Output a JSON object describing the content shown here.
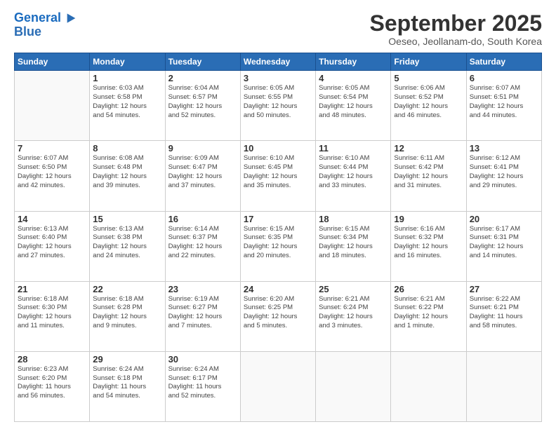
{
  "logo": {
    "line1": "General",
    "line2": "Blue"
  },
  "title": "September 2025",
  "subtitle": "Oeseo, Jeollanam-do, South Korea",
  "days_of_week": [
    "Sunday",
    "Monday",
    "Tuesday",
    "Wednesday",
    "Thursday",
    "Friday",
    "Saturday"
  ],
  "weeks": [
    [
      {
        "day": "",
        "info": ""
      },
      {
        "day": "1",
        "info": "Sunrise: 6:03 AM\nSunset: 6:58 PM\nDaylight: 12 hours\nand 54 minutes."
      },
      {
        "day": "2",
        "info": "Sunrise: 6:04 AM\nSunset: 6:57 PM\nDaylight: 12 hours\nand 52 minutes."
      },
      {
        "day": "3",
        "info": "Sunrise: 6:05 AM\nSunset: 6:55 PM\nDaylight: 12 hours\nand 50 minutes."
      },
      {
        "day": "4",
        "info": "Sunrise: 6:05 AM\nSunset: 6:54 PM\nDaylight: 12 hours\nand 48 minutes."
      },
      {
        "day": "5",
        "info": "Sunrise: 6:06 AM\nSunset: 6:52 PM\nDaylight: 12 hours\nand 46 minutes."
      },
      {
        "day": "6",
        "info": "Sunrise: 6:07 AM\nSunset: 6:51 PM\nDaylight: 12 hours\nand 44 minutes."
      }
    ],
    [
      {
        "day": "7",
        "info": "Sunrise: 6:07 AM\nSunset: 6:50 PM\nDaylight: 12 hours\nand 42 minutes."
      },
      {
        "day": "8",
        "info": "Sunrise: 6:08 AM\nSunset: 6:48 PM\nDaylight: 12 hours\nand 39 minutes."
      },
      {
        "day": "9",
        "info": "Sunrise: 6:09 AM\nSunset: 6:47 PM\nDaylight: 12 hours\nand 37 minutes."
      },
      {
        "day": "10",
        "info": "Sunrise: 6:10 AM\nSunset: 6:45 PM\nDaylight: 12 hours\nand 35 minutes."
      },
      {
        "day": "11",
        "info": "Sunrise: 6:10 AM\nSunset: 6:44 PM\nDaylight: 12 hours\nand 33 minutes."
      },
      {
        "day": "12",
        "info": "Sunrise: 6:11 AM\nSunset: 6:42 PM\nDaylight: 12 hours\nand 31 minutes."
      },
      {
        "day": "13",
        "info": "Sunrise: 6:12 AM\nSunset: 6:41 PM\nDaylight: 12 hours\nand 29 minutes."
      }
    ],
    [
      {
        "day": "14",
        "info": "Sunrise: 6:13 AM\nSunset: 6:40 PM\nDaylight: 12 hours\nand 27 minutes."
      },
      {
        "day": "15",
        "info": "Sunrise: 6:13 AM\nSunset: 6:38 PM\nDaylight: 12 hours\nand 24 minutes."
      },
      {
        "day": "16",
        "info": "Sunrise: 6:14 AM\nSunset: 6:37 PM\nDaylight: 12 hours\nand 22 minutes."
      },
      {
        "day": "17",
        "info": "Sunrise: 6:15 AM\nSunset: 6:35 PM\nDaylight: 12 hours\nand 20 minutes."
      },
      {
        "day": "18",
        "info": "Sunrise: 6:15 AM\nSunset: 6:34 PM\nDaylight: 12 hours\nand 18 minutes."
      },
      {
        "day": "19",
        "info": "Sunrise: 6:16 AM\nSunset: 6:32 PM\nDaylight: 12 hours\nand 16 minutes."
      },
      {
        "day": "20",
        "info": "Sunrise: 6:17 AM\nSunset: 6:31 PM\nDaylight: 12 hours\nand 14 minutes."
      }
    ],
    [
      {
        "day": "21",
        "info": "Sunrise: 6:18 AM\nSunset: 6:30 PM\nDaylight: 12 hours\nand 11 minutes."
      },
      {
        "day": "22",
        "info": "Sunrise: 6:18 AM\nSunset: 6:28 PM\nDaylight: 12 hours\nand 9 minutes."
      },
      {
        "day": "23",
        "info": "Sunrise: 6:19 AM\nSunset: 6:27 PM\nDaylight: 12 hours\nand 7 minutes."
      },
      {
        "day": "24",
        "info": "Sunrise: 6:20 AM\nSunset: 6:25 PM\nDaylight: 12 hours\nand 5 minutes."
      },
      {
        "day": "25",
        "info": "Sunrise: 6:21 AM\nSunset: 6:24 PM\nDaylight: 12 hours\nand 3 minutes."
      },
      {
        "day": "26",
        "info": "Sunrise: 6:21 AM\nSunset: 6:22 PM\nDaylight: 12 hours\nand 1 minute."
      },
      {
        "day": "27",
        "info": "Sunrise: 6:22 AM\nSunset: 6:21 PM\nDaylight: 11 hours\nand 58 minutes."
      }
    ],
    [
      {
        "day": "28",
        "info": "Sunrise: 6:23 AM\nSunset: 6:20 PM\nDaylight: 11 hours\nand 56 minutes."
      },
      {
        "day": "29",
        "info": "Sunrise: 6:24 AM\nSunset: 6:18 PM\nDaylight: 11 hours\nand 54 minutes."
      },
      {
        "day": "30",
        "info": "Sunrise: 6:24 AM\nSunset: 6:17 PM\nDaylight: 11 hours\nand 52 minutes."
      },
      {
        "day": "",
        "info": ""
      },
      {
        "day": "",
        "info": ""
      },
      {
        "day": "",
        "info": ""
      },
      {
        "day": "",
        "info": ""
      }
    ]
  ]
}
